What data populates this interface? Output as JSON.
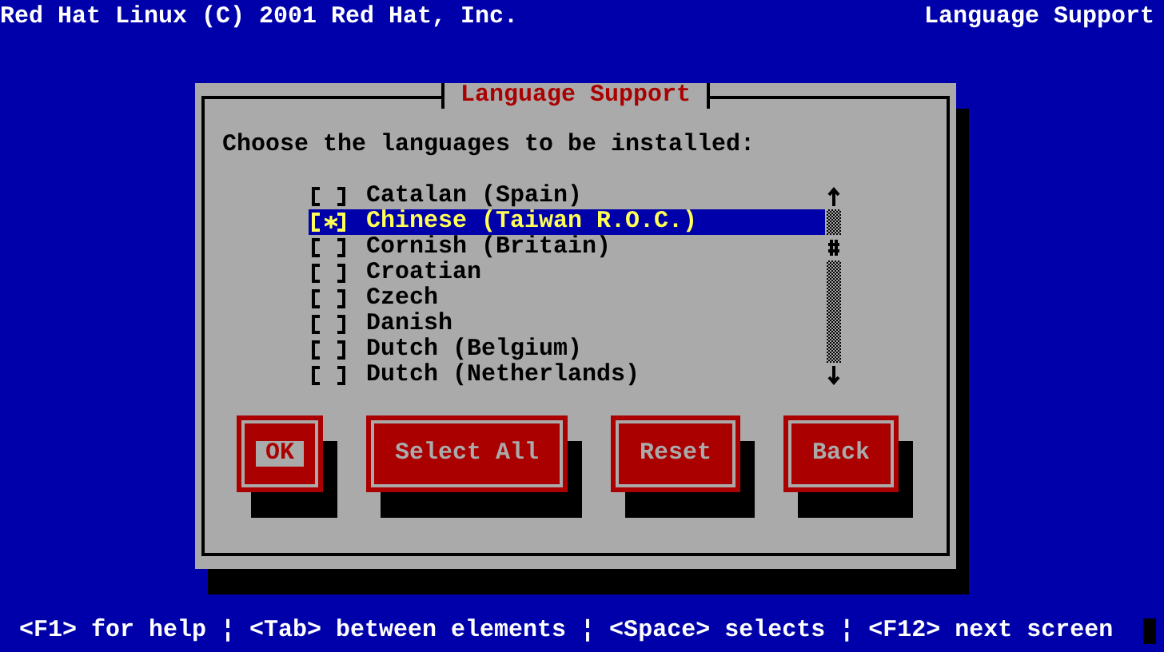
{
  "header": {
    "left": "Red Hat Linux (C) 2001 Red Hat, Inc.",
    "right": "Language Support"
  },
  "dialog": {
    "title": "Language Support",
    "prompt": "Choose the languages to be installed:",
    "languages": [
      {
        "label": "Catalan (Spain)",
        "checked": false,
        "selected": false
      },
      {
        "label": "Chinese (Taiwan R.O.C.)",
        "checked": true,
        "selected": true
      },
      {
        "label": "Cornish (Britain)",
        "checked": false,
        "selected": false
      },
      {
        "label": "Croatian",
        "checked": false,
        "selected": false
      },
      {
        "label": "Czech",
        "checked": false,
        "selected": false
      },
      {
        "label": "Danish",
        "checked": false,
        "selected": false
      },
      {
        "label": "Dutch (Belgium)",
        "checked": false,
        "selected": false
      },
      {
        "label": "Dutch (Netherlands)",
        "checked": false,
        "selected": false
      }
    ],
    "buttons": [
      {
        "label": "OK",
        "focused": true
      },
      {
        "label": "Select All",
        "focused": false
      },
      {
        "label": "Reset",
        "focused": false
      },
      {
        "label": "Back",
        "focused": false
      }
    ]
  },
  "status_bar": "<F1> for help ¦ <Tab> between elements ¦ <Space> selects ¦ <F12> next screen"
}
